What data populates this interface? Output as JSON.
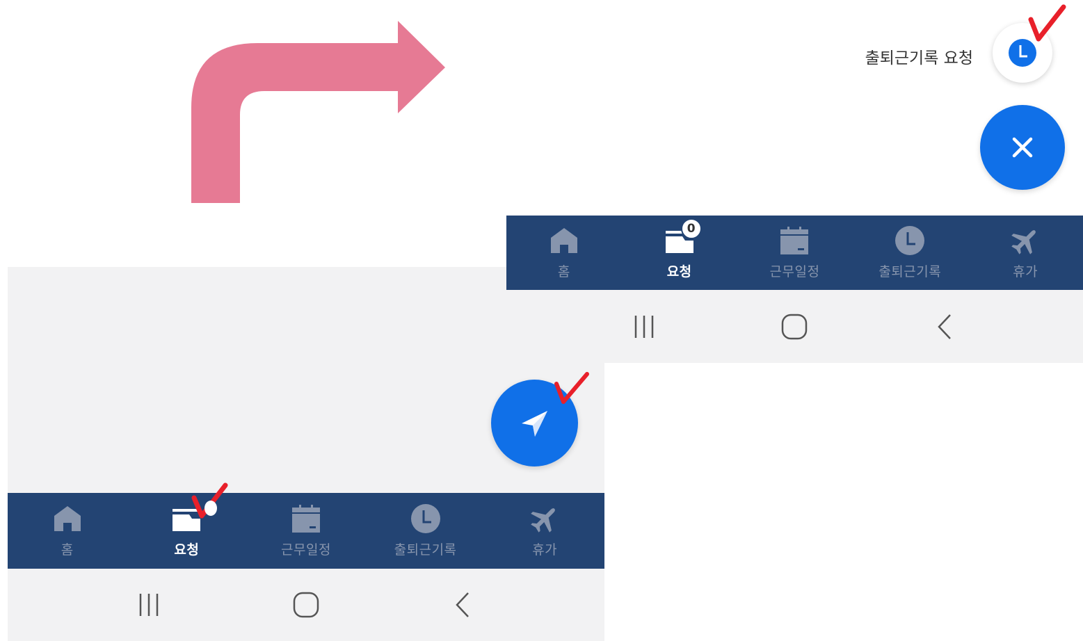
{
  "nav_items": [
    {
      "label": "홈",
      "icon": "home-icon",
      "active": false
    },
    {
      "label": "요청",
      "icon": "request-inbox-icon",
      "active": true
    },
    {
      "label": "근무일정",
      "icon": "calendar-icon",
      "active": false
    },
    {
      "label": "출퇴근기록",
      "icon": "clock-icon",
      "active": false
    },
    {
      "label": "휴가",
      "icon": "airplane-icon",
      "active": false
    }
  ],
  "badge_count": "0",
  "fab_menu": {
    "attendance_request_label": "출퇴근기록 요청"
  },
  "system_nav": [
    "recent-apps-icon",
    "home-circle-icon",
    "back-chevron-icon"
  ],
  "colors": {
    "navbar_bg": "#234473",
    "nav_inactive": "#8795ad",
    "fab_blue": "#1070e8",
    "guide_arrow": "#e67a94",
    "check_mark": "#e8202a",
    "background_gray": "#f2f2f3"
  }
}
